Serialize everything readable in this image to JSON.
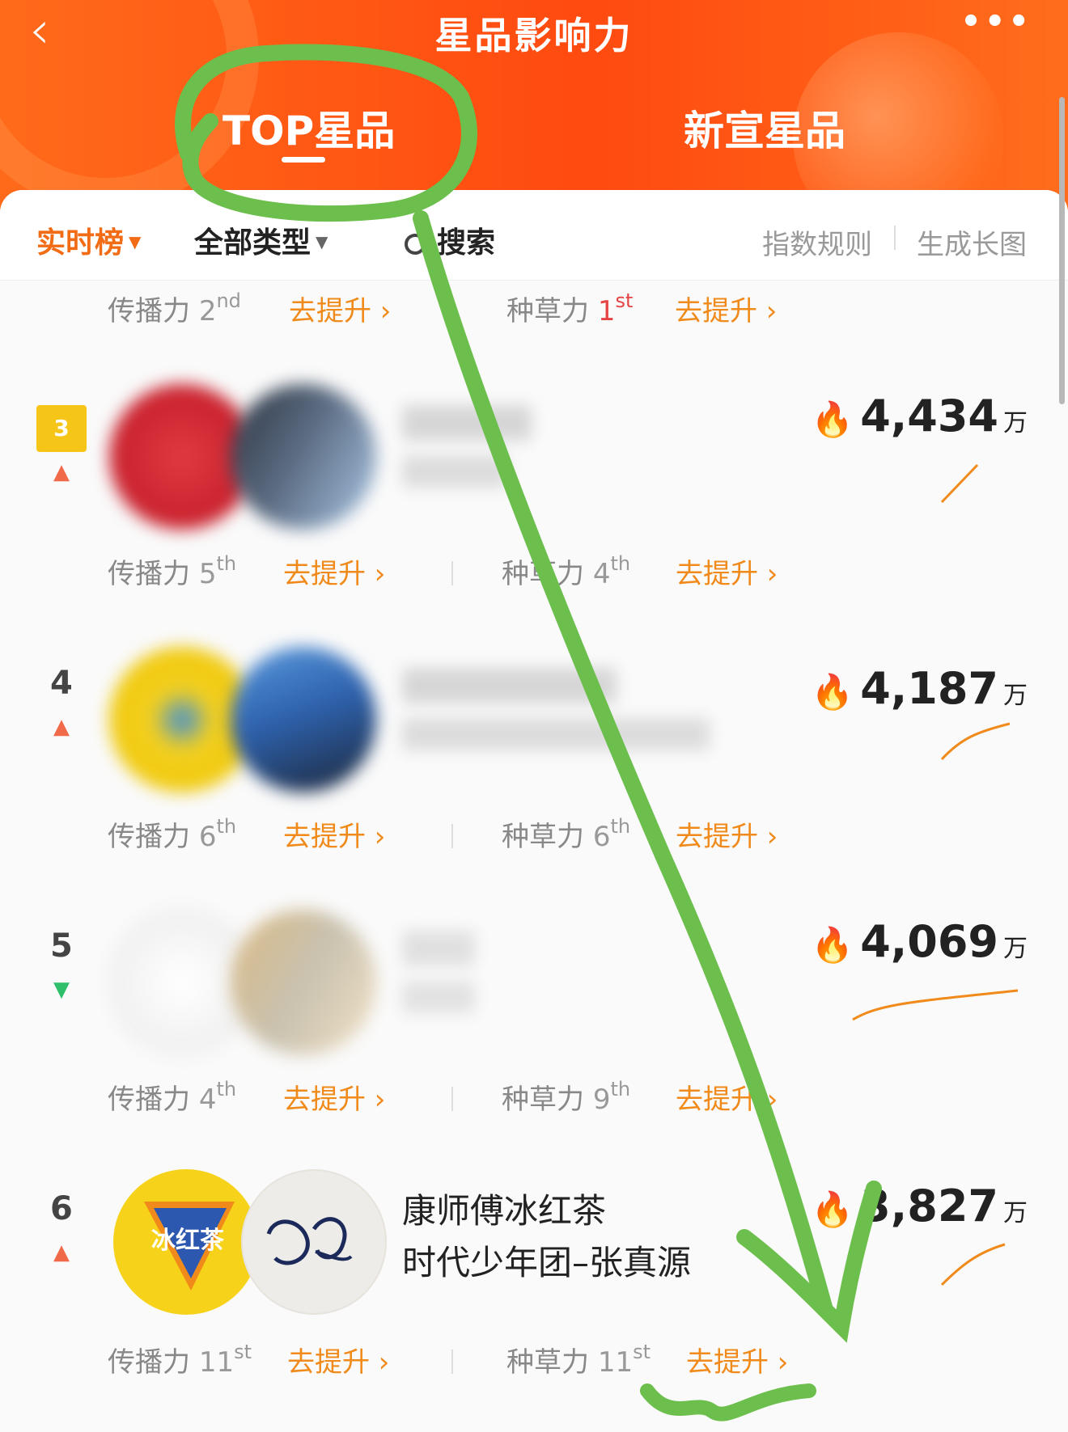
{
  "header": {
    "back_glyph": "‹",
    "title": "星品影响力",
    "more_glyph": "•••",
    "tabs": [
      {
        "label": "TOP星品",
        "active": true
      },
      {
        "label": "新宣星品",
        "active": false
      }
    ]
  },
  "filter": {
    "realtime_label": "实时榜",
    "type_label": "全部类型",
    "search_label": "搜索",
    "rules_label": "指数规则",
    "long_image_label": "生成长图",
    "caret_glyph": "▼"
  },
  "labels": {
    "spread": "传播力",
    "seed": "种草力",
    "boost": "去提升 ›",
    "unit": "万",
    "fire_glyph": "🔥"
  },
  "top_stats": {
    "spread_rank": "2",
    "spread_suffix": "nd",
    "seed_rank": "1",
    "seed_suffix": "st"
  },
  "rows": [
    {
      "rank": "3",
      "trend": "up",
      "score": "4,434",
      "line1": "",
      "line2": "",
      "spread_rank": "5",
      "spread_suffix": "th",
      "seed_rank": "4",
      "seed_suffix": "th"
    },
    {
      "rank": "4",
      "trend": "up",
      "score": "4,187",
      "line1": "",
      "line2": "",
      "spread_rank": "6",
      "spread_suffix": "th",
      "seed_rank": "6",
      "seed_suffix": "th"
    },
    {
      "rank": "5",
      "trend": "down",
      "score": "4,069",
      "line1": "",
      "line2": "",
      "spread_rank": "4",
      "spread_suffix": "th",
      "seed_rank": "9",
      "seed_suffix": "th"
    },
    {
      "rank": "6",
      "trend": "up",
      "score": "3,827",
      "line1": "康师傅冰红茶",
      "line2": "时代少年团–张真源",
      "spread_rank": "11",
      "spread_suffix": "st",
      "seed_rank": "11",
      "seed_suffix": "st"
    }
  ],
  "avatar_logo_text": "冰红茶",
  "colors": {
    "header_orange": "#ff4a10",
    "accent_orange": "#f26b15",
    "badge_gold": "#f5c518",
    "annotation_green": "#6cbf4c"
  }
}
